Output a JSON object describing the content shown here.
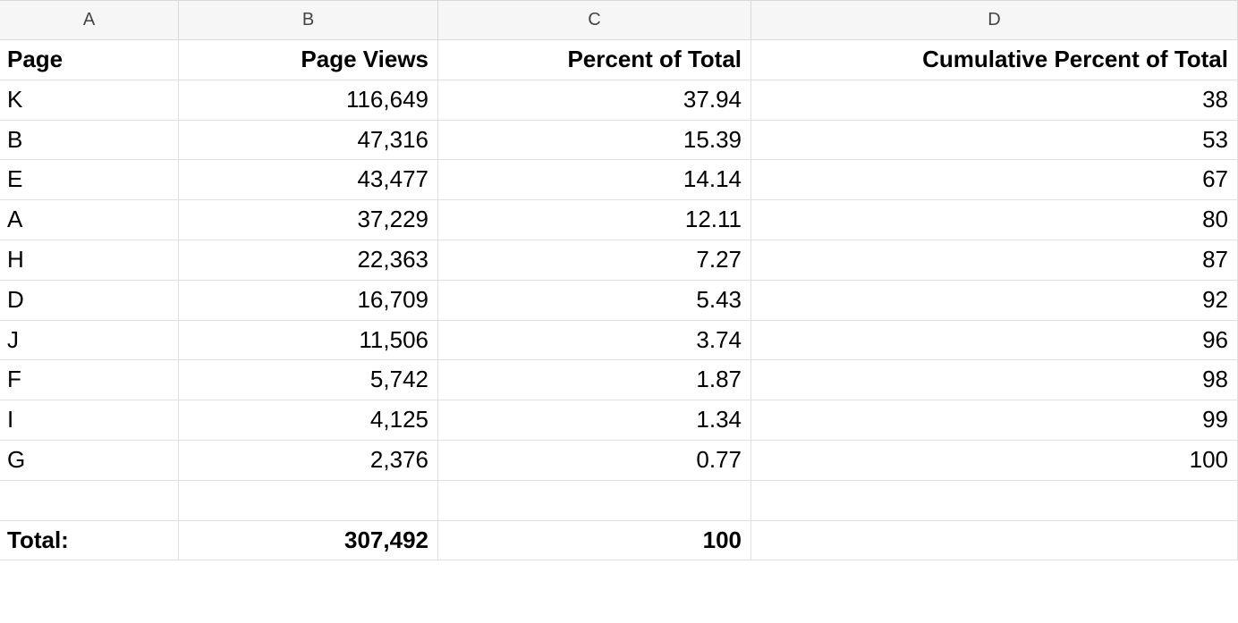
{
  "columns": [
    "A",
    "B",
    "C",
    "D"
  ],
  "headers": {
    "page": "Page",
    "views": "Page Views",
    "pct": "Percent of Total",
    "cum": "Cumulative Percent of Total"
  },
  "rows": [
    {
      "page": "K",
      "views": "116,649",
      "pct": "37.94",
      "cum": "38"
    },
    {
      "page": "B",
      "views": "47,316",
      "pct": "15.39",
      "cum": "53"
    },
    {
      "page": "E",
      "views": "43,477",
      "pct": "14.14",
      "cum": "67"
    },
    {
      "page": "A",
      "views": "37,229",
      "pct": "12.11",
      "cum": "80"
    },
    {
      "page": "H",
      "views": "22,363",
      "pct": "7.27",
      "cum": "87"
    },
    {
      "page": "D",
      "views": "16,709",
      "pct": "5.43",
      "cum": "92"
    },
    {
      "page": "J",
      "views": "11,506",
      "pct": "3.74",
      "cum": "96"
    },
    {
      "page": "F",
      "views": "5,742",
      "pct": "1.87",
      "cum": "98"
    },
    {
      "page": "I",
      "views": "4,125",
      "pct": "1.34",
      "cum": "99"
    },
    {
      "page": "G",
      "views": "2,376",
      "pct": "0.77",
      "cum": "100"
    }
  ],
  "blank": "",
  "total": {
    "label": "Total:",
    "views": "307,492",
    "pct": "100",
    "cum": ""
  }
}
